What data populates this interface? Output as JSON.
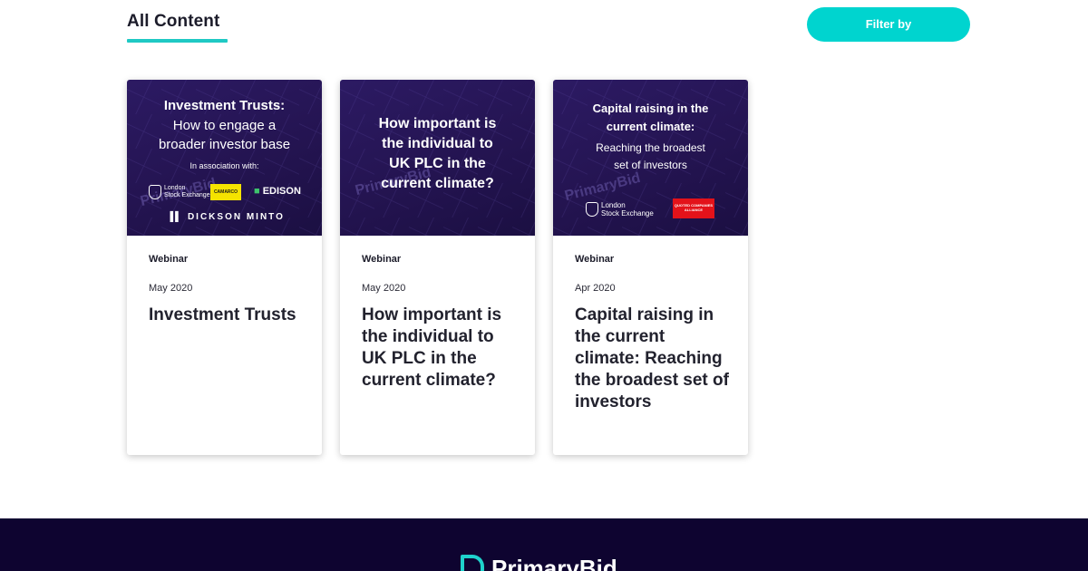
{
  "header": {
    "title": "All Content",
    "filter_label": "Filter by"
  },
  "cards": [
    {
      "type": "Webinar",
      "date": "May 2020",
      "title": "Investment Trusts",
      "image": {
        "heading": "Investment Trusts:",
        "line1": "How to engage a",
        "line2": "broader investor base",
        "assoc": "In association with:",
        "lse_line1": "London",
        "lse_line2": "Stock Exchange",
        "camarco": "CAMARCO",
        "edison": "EDISON",
        "dickson": "DICKSON MINTO",
        "watermark": "PrimaryBid"
      }
    },
    {
      "type": "Webinar",
      "date": "May 2020",
      "title": "How important is the individual to UK PLC in the current climate?",
      "image": {
        "line1": "How important is",
        "line2": "the individual to",
        "line3": "UK PLC in the",
        "line4": "current climate?",
        "watermark": "PrimaryBid"
      }
    },
    {
      "type": "Webinar",
      "date": "Apr 2020",
      "title": "Capital raising in the current climate: Reaching the broadest set of investors",
      "image": {
        "line1": "Capital raising in the",
        "line2": "current climate:",
        "line3": "Reaching the broadest",
        "line4": "set of investors",
        "lse_line1": "London",
        "lse_line2": "Stock Exchange",
        "qca": "QUOTED COMPANIES ALLIANCE",
        "watermark": "PrimaryBid"
      }
    }
  ],
  "footer": {
    "brand": "PrimaryBid"
  },
  "colors": {
    "accent": "#00d4cf",
    "footer_bg": "#0e0430",
    "card_image_bg": "#241451"
  }
}
